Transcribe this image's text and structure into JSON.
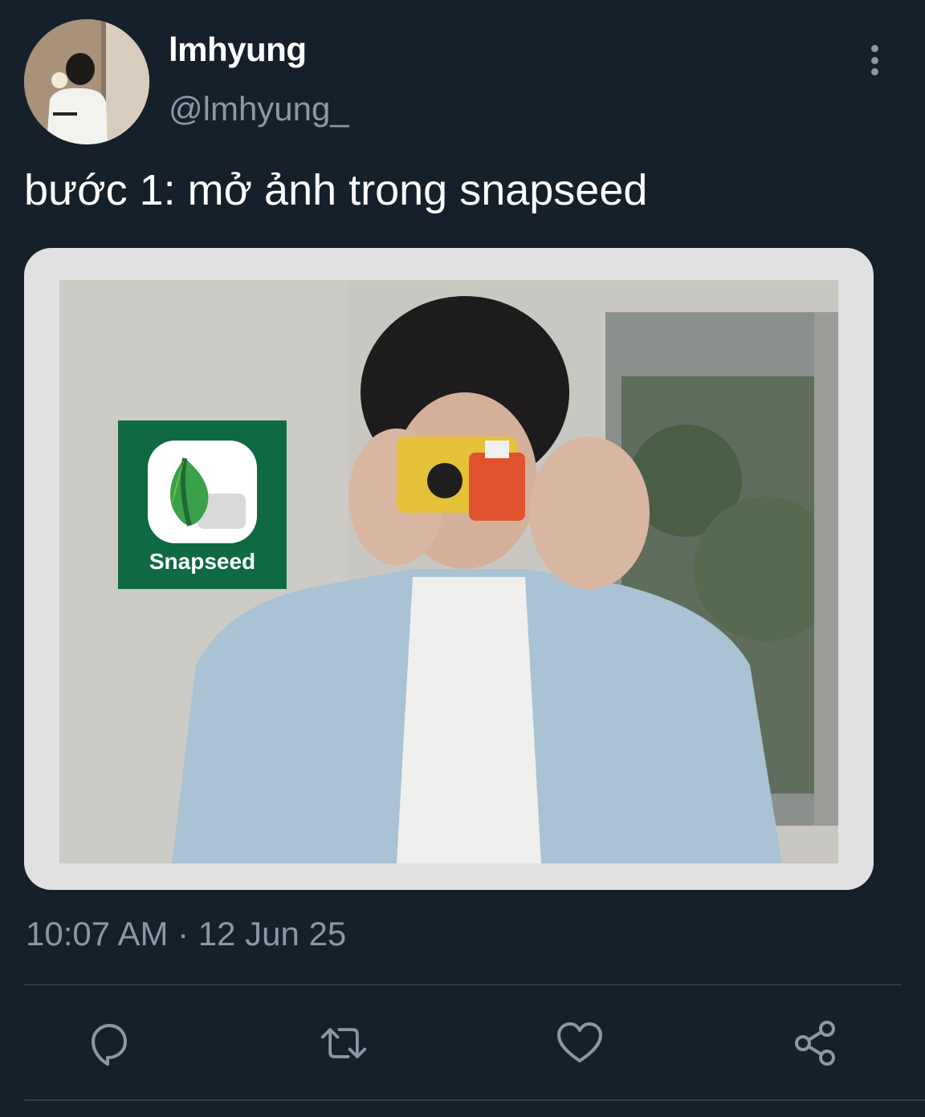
{
  "tweet": {
    "display_name": "lmhyung",
    "handle": "@lmhyung_",
    "text": "bước 1: mở ảnh trong snapseed",
    "timestamp": "10:07 AM · 12 Jun 25"
  },
  "media": {
    "app_badge_label": "Snapseed"
  },
  "actions": {
    "icons": [
      "reply-icon",
      "retweet-icon",
      "like-icon",
      "share-icon"
    ]
  },
  "colors": {
    "background": "#16202b",
    "secondary_text": "#8899a6",
    "snapseed_green": "#0f6a43"
  }
}
